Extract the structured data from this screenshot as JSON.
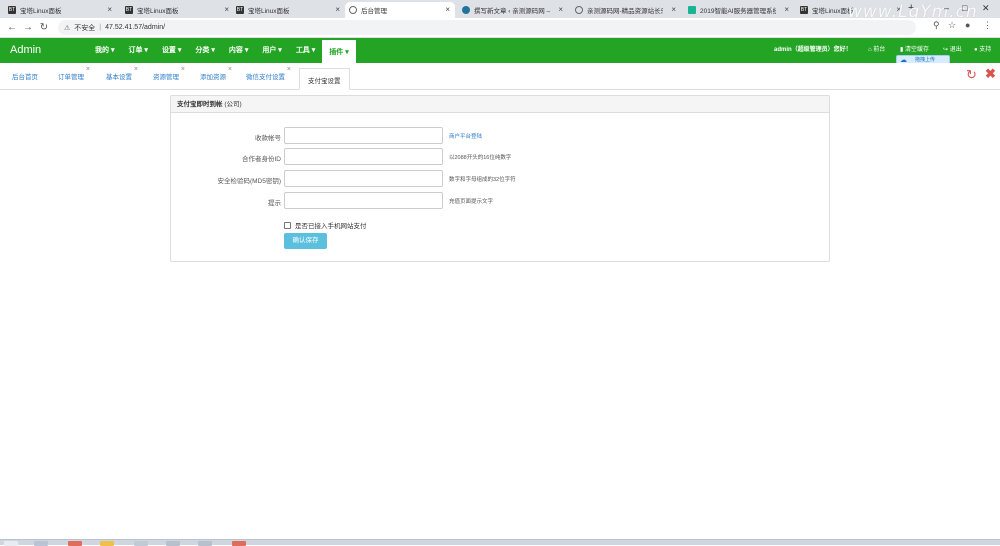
{
  "browser": {
    "tabs": [
      {
        "title": "宝塔Linux面板",
        "icon": "bt-icon",
        "active": false
      },
      {
        "title": "宝塔Linux面板",
        "icon": "bt-icon",
        "active": false
      },
      {
        "title": "宝塔Linux面板",
        "icon": "bt-icon",
        "active": false
      },
      {
        "title": "后台管理",
        "icon": "globe-icon",
        "active": true
      },
      {
        "title": "撰写新文章 ‹ 亲测源码网 —",
        "icon": "wordpress-icon",
        "active": false
      },
      {
        "title": "亲测源码网-精品资源站长乐",
        "icon": "globe-icon",
        "active": false
      },
      {
        "title": "2019智能AI服务器管理系统",
        "icon": "ai-icon",
        "active": false
      },
      {
        "title": "宝塔Linux面板",
        "icon": "bt-icon",
        "active": false
      }
    ],
    "fav_text": "BT",
    "new_tab": "+",
    "close_glyph": "×",
    "insecure_label": "不安全",
    "url": "47.52.41.57/admin/",
    "watermark": "www.LqYm.cn"
  },
  "header": {
    "logo": "Admin",
    "menu": [
      {
        "label": "我的 ▾",
        "active": false
      },
      {
        "label": "订单 ▾",
        "active": false
      },
      {
        "label": "设置 ▾",
        "active": false
      },
      {
        "label": "分类 ▾",
        "active": false
      },
      {
        "label": "内容 ▾",
        "active": false
      },
      {
        "label": "用户 ▾",
        "active": false
      },
      {
        "label": "工具 ▾",
        "active": false
      },
      {
        "label": "插件 ▾",
        "active": true
      }
    ],
    "user_greeting": "admin（超级管理员）您好！",
    "home_label": "前台",
    "clear_cache_label": "清空缓存",
    "logout_label": "退出",
    "support_label": "支持",
    "upload_tip": "拖拽上传"
  },
  "subtabs": [
    {
      "label": "后台首页",
      "closable": false,
      "active": false
    },
    {
      "label": "订单管理",
      "closable": true,
      "active": false
    },
    {
      "label": "基本设置",
      "closable": true,
      "active": false
    },
    {
      "label": "资源管理",
      "closable": true,
      "active": false
    },
    {
      "label": "添加资源",
      "closable": true,
      "active": false
    },
    {
      "label": "微信支付设置",
      "closable": true,
      "active": false
    },
    {
      "label": "支付宝设置",
      "closable": true,
      "active": true
    }
  ],
  "panel": {
    "title": "支付宝即时到帐",
    "title_note": "(公司)",
    "fields": [
      {
        "label": "收款帐号",
        "value": "",
        "hint": "商户平台登陆",
        "hint_is_link": true
      },
      {
        "label": "合作者身份ID",
        "value": "",
        "hint": "以2088开头的16位纯数字",
        "hint_is_link": false
      },
      {
        "label": "安全检验码(MD5密钥)",
        "value": "",
        "hint": "数字和字母组成的32位字符",
        "hint_is_link": false
      },
      {
        "label": "提示",
        "value": "",
        "hint": "充值页面提示文字",
        "hint_is_link": false
      }
    ],
    "checkbox_label": "是否已接入手机网站支付",
    "checkbox_checked": false,
    "save_label": "确认保存"
  },
  "colors": {
    "header_green": "#24a424",
    "link_blue": "#2b7cc9",
    "save_button": "#5bc0de",
    "danger_red": "#d9534f"
  }
}
